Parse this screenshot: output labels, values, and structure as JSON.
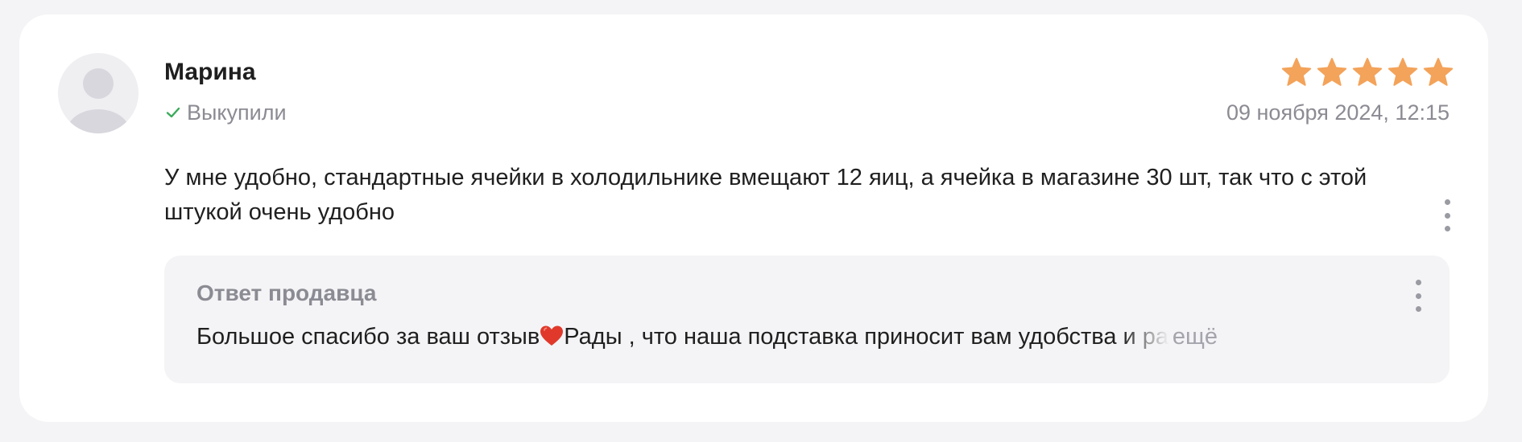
{
  "review": {
    "author": "Марина",
    "purchase_status": "Выкупили",
    "rating": 5,
    "rating_max": 5,
    "date": "09 ноября 2024, 12:15",
    "text": "У мне удобно, стандартные ячейки в холодильнике вмещают 12 яиц, а ячейка в магазине 30 шт, так что с этой штукой очень удобно"
  },
  "seller_reply": {
    "title": "Ответ продавца",
    "text_before_emoji": "Большое спасибо за ваш отзыв",
    "emoji": "heart",
    "text_after_emoji": "Рады , что наша подставка приносит вам удобства и радость",
    "more_label": "ещё"
  },
  "icons": {
    "avatar": "user-placeholder-icon",
    "purchase": "check-icon",
    "rating": "star-icon",
    "menu": "kebab-menu-icon"
  },
  "colors": {
    "star": "#f3a35a",
    "check": "#3aaa5a",
    "heart": "#e0392b",
    "muted_text": "#8b8b93",
    "reply_background": "#f4f4f6",
    "page_background": "#f4f4f6"
  }
}
